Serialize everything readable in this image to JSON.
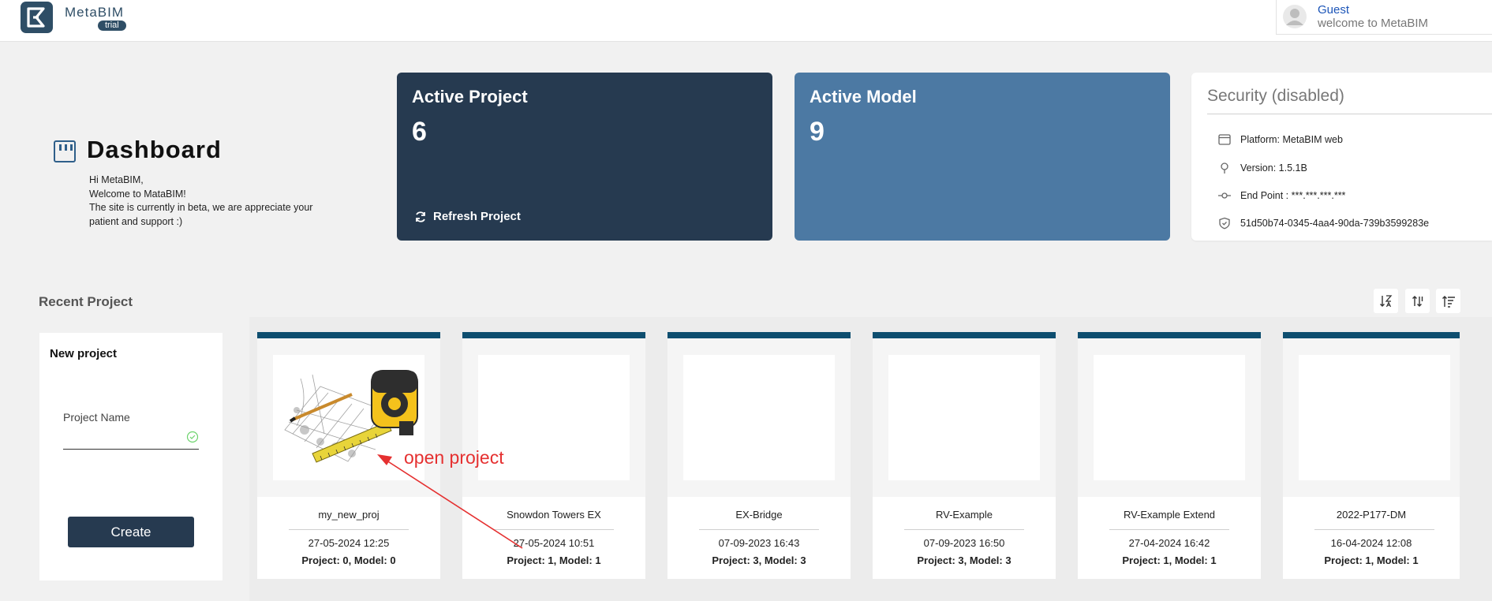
{
  "header": {
    "brand": "MetaBIM",
    "badge": "trial",
    "user_name": "Guest",
    "user_subtitle": "welcome to MetaBIM"
  },
  "dashboard": {
    "title": "Dashboard",
    "greeting_lines": [
      "Hi MetaBIM,",
      "Welcome to MataBIM!",
      "The site is currently in beta, we are appreciate your patient and support :)"
    ]
  },
  "stats": {
    "active_project": {
      "title": "Active Project",
      "value": "6",
      "action": "Refresh Project"
    },
    "active_model": {
      "title": "Active Model",
      "value": "9"
    }
  },
  "security": {
    "title": "Security (disabled)",
    "rows": [
      {
        "icon": "browser-window-icon",
        "text": "Platform: MetaBIM web"
      },
      {
        "icon": "map-pin-icon",
        "text": "Version: 1.5.1B"
      },
      {
        "icon": "commit-node-icon",
        "text": "End Point : ***.***.***.***"
      },
      {
        "icon": "shield-check-icon",
        "text": "51d50b74-0345-4aa4-90da-739b3599283e"
      }
    ]
  },
  "recent": {
    "title": "Recent Project",
    "sort_buttons": [
      "sort-alpha-icon",
      "sort-updown-icon",
      "sort-lines-icon"
    ],
    "new_project": {
      "title": "New project",
      "field_label": "Project Name",
      "field_value": "",
      "create_label": "Create"
    },
    "projects": [
      {
        "name": "my_new_proj",
        "date": "27-05-2024 12:25",
        "counts": "Project: 0, Model: 0",
        "has_image": true
      },
      {
        "name": "Snowdon Towers EX",
        "date": "27-05-2024 10:51",
        "counts": "Project: 1, Model: 1",
        "has_image": false
      },
      {
        "name": "EX-Bridge",
        "date": "07-09-2023 16:43",
        "counts": "Project: 3, Model: 3",
        "has_image": false
      },
      {
        "name": "RV-Example",
        "date": "07-09-2023 16:50",
        "counts": "Project: 3, Model: 3",
        "has_image": false
      },
      {
        "name": "RV-Example Extend",
        "date": "27-04-2024 16:42",
        "counts": "Project: 1, Model: 1",
        "has_image": false
      },
      {
        "name": "2022-P177-DM",
        "date": "16-04-2024 12:08",
        "counts": "Project: 1, Model: 1",
        "has_image": false
      }
    ]
  },
  "annotation": {
    "text": "open project",
    "color": "#e53030"
  },
  "colors": {
    "navy": "#263a50",
    "steel_blue": "#4c79a3",
    "card_bar": "#0e4e6f",
    "link_blue": "#1c55b8"
  }
}
